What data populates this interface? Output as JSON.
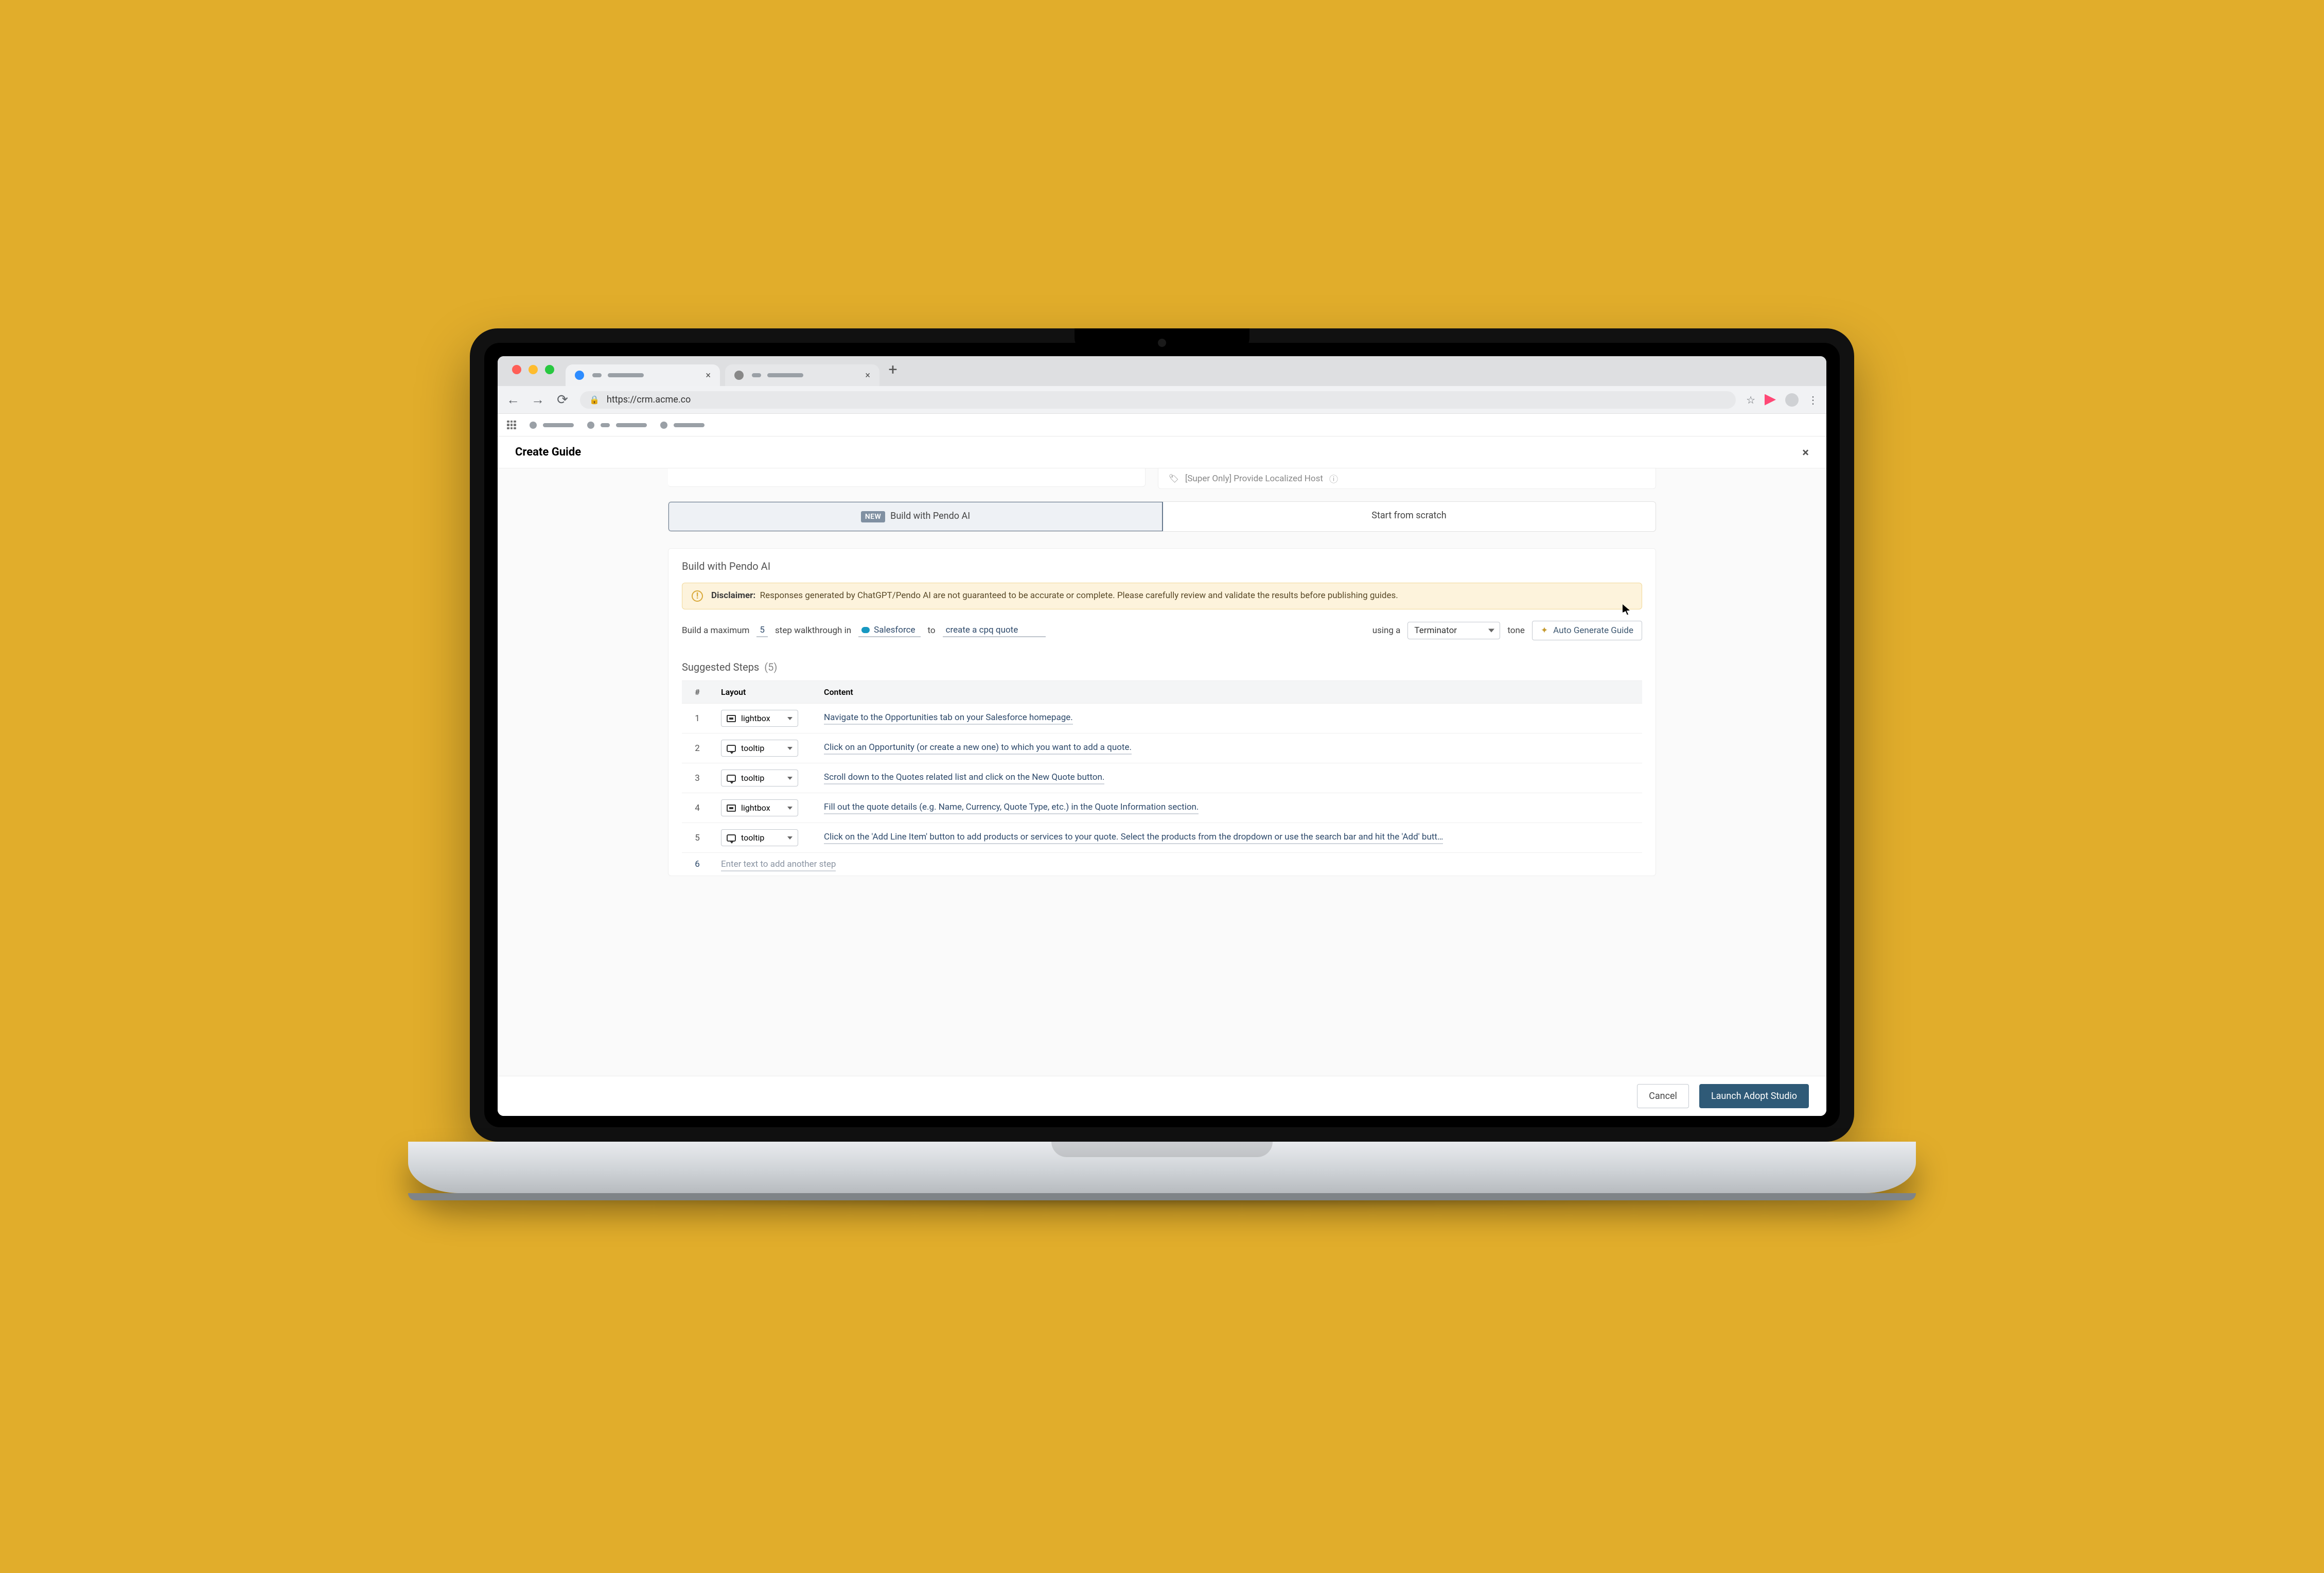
{
  "browser": {
    "url": "https://crm.acme.co"
  },
  "header": {
    "title": "Create Guide"
  },
  "stub": {
    "text": "[Super Only] Provide Localized Host"
  },
  "tabs": {
    "build_badge": "NEW",
    "build_label": "Build with Pendo AI",
    "scratch_label": "Start from scratch"
  },
  "section": {
    "title": "Build with Pendo AI"
  },
  "disclaimer": {
    "label": "Disclaimer:",
    "text": "Responses generated by ChatGPT/Pendo AI are not guaranteed to be accurate or complete. Please carefully review and validate the results before publishing guides."
  },
  "builder": {
    "prefix": "Build a maximum",
    "step_count": "5",
    "mid1": "step  walkthrough in",
    "platform": "Salesforce",
    "mid2": "to",
    "goal": "create a cpq quote",
    "using": "using a",
    "tone_value": "Terminator",
    "tone_suffix": "tone",
    "generate_label": "Auto Generate Guide"
  },
  "steps": {
    "title": "Suggested Steps",
    "count_display": "(5)",
    "cols": {
      "num": "#",
      "layout": "Layout",
      "content": "Content"
    },
    "rows": [
      {
        "n": "1",
        "layout": "lightbox",
        "content": "Navigate to the Opportunities tab on your Salesforce homepage."
      },
      {
        "n": "2",
        "layout": "tooltip",
        "content": "Click on an Opportunity (or create a new one) to which you want to add a quote."
      },
      {
        "n": "3",
        "layout": "tooltip",
        "content": "Scroll down to the Quotes related list and click on the New Quote button."
      },
      {
        "n": "4",
        "layout": "lightbox",
        "content": "Fill out the quote details (e.g. Name, Currency, Quote Type, etc.) in the Quote Information section."
      },
      {
        "n": "5",
        "layout": "tooltip",
        "content": "Click on the 'Add Line Item' button to add products or services to your quote. Select the products from the dropdown or use the search bar and hit the 'Add' butt…"
      }
    ],
    "new_row_n": "6",
    "new_row_placeholder": "Enter text to add another step"
  },
  "footer": {
    "cancel": "Cancel",
    "launch": "Launch Adopt Studio"
  }
}
